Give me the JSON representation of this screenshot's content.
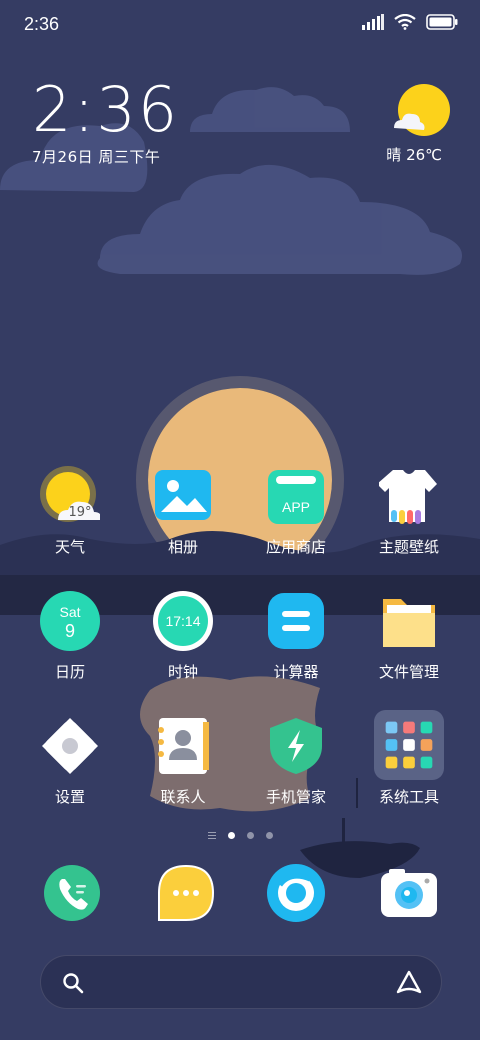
{
  "status_bar": {
    "time": "2:36"
  },
  "clock_widget": {
    "time": "2:36",
    "date": "7月26日 周三下午"
  },
  "weather_widget": {
    "summary": "晴 26℃"
  },
  "apps": {
    "weather": {
      "label": "天气",
      "temp": "19°"
    },
    "gallery": {
      "label": "相册"
    },
    "app_store": {
      "label": "应用商店",
      "badge_text": "APP"
    },
    "themes": {
      "label": "主题壁纸"
    },
    "calendar": {
      "label": "日历",
      "day_name": "Sat",
      "day_num": "9"
    },
    "clock": {
      "label": "时钟",
      "time": "17:14"
    },
    "calculator": {
      "label": "计算器"
    },
    "file_manager": {
      "label": "文件管理"
    },
    "settings": {
      "label": "设置"
    },
    "contacts": {
      "label": "联系人"
    },
    "security": {
      "label": "手机管家"
    },
    "system_tools": {
      "label": "系统工具"
    }
  },
  "page_indicator": {
    "pages": 3,
    "active": 1
  },
  "dock": [
    "phone-icon",
    "messages-icon",
    "browser-icon",
    "camera-icon"
  ],
  "colors": {
    "sky": "#353c63",
    "moon": "#e9b97a",
    "teal": "#27d8b3",
    "blue": "#1fb8f0",
    "yellow": "#fbcf3c"
  }
}
